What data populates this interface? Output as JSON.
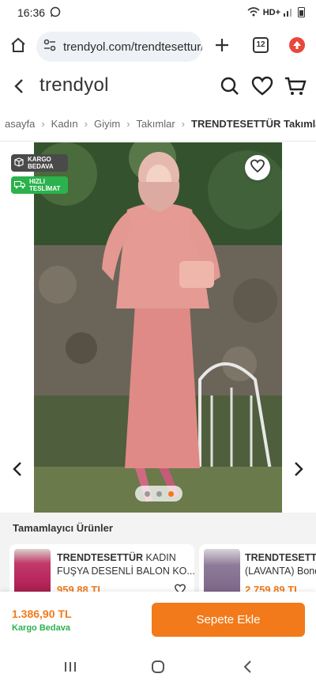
{
  "status": {
    "time": "16:36",
    "network": "HD+"
  },
  "browser": {
    "url": "trendyol.com/trendtesettur/",
    "tab_count": "12"
  },
  "header": {
    "logo": "trendyol"
  },
  "breadcrumb": [
    "asayfa",
    "Kadın",
    "Giyim",
    "Takımlar",
    "TRENDTESETTÜR Takımlar"
  ],
  "badges": {
    "kargo": [
      "KARGO",
      "BEDAVA"
    ],
    "hizli": [
      "HIZLI",
      "TESLİMAT"
    ]
  },
  "gallery": {
    "dot_count": 3,
    "active_index": 2
  },
  "complementary": {
    "title": "Tamamlayıcı Ürünler",
    "items": [
      {
        "brand": "TRENDTESETTÜR",
        "name_inline": "KADIN",
        "name_line2": "FUŞYA DESENLİ BALON KO...",
        "price": "959,88 TL"
      },
      {
        "brand": "TRENDTESETTÜ",
        "name_line2": "(LAVANTA) Bond",
        "price": "2.759,89 TL"
      }
    ]
  },
  "purchase": {
    "price": "1.386,90 TL",
    "shipping": "Kargo Bedava",
    "button": "Sepete Ekle"
  },
  "colors": {
    "brand_orange": "#f27a1a",
    "green": "#2bb24c"
  }
}
